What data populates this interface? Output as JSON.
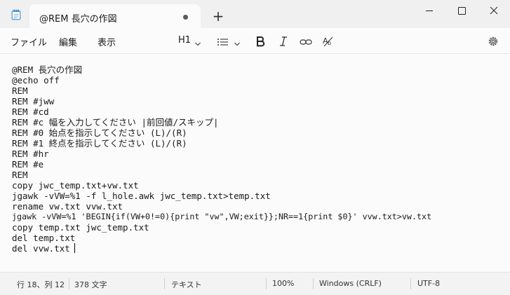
{
  "window": {
    "tab_title": "@REM 長穴の作図",
    "new_tab": "+",
    "controls": [
      "minimize",
      "maximize",
      "close"
    ]
  },
  "menu": {
    "file": "ファイル",
    "edit": "編集",
    "view": "表示"
  },
  "toolbar": {
    "heading": "H1",
    "icons": [
      "chevron-down-icon",
      "list-icon",
      "bold-icon",
      "italic-icon",
      "link-icon",
      "clear-format-icon",
      "gear-icon"
    ]
  },
  "editor": {
    "lines": [
      "",
      "@REM 長穴の作図",
      "@echo off",
      "REM",
      "REM #jww",
      "REM #cd",
      "REM #c 幅を入力してください |前回値/スキップ|",
      "REM #0 始点を指示してください (L)/(R)",
      "REM #1 終点を指示してください (L)/(R)",
      "REM #hr",
      "REM #e",
      "REM",
      "copy jwc_temp.txt+vw.txt",
      "jgawk -vVW=%1 -f l_hole.awk jwc_temp.txt>temp.txt",
      "rename vw.txt vvw.txt",
      "jgawk -vVW=%1 'BEGIN{if(VW+0!=0){print \"vw\",VW;exit}};NR==1{print $0}' vvw.txt>vw.txt",
      "copy temp.txt jwc_temp.txt",
      "del temp.txt",
      "del vvw.txt"
    ]
  },
  "status": {
    "position": "行 18、列 12",
    "chars": "378 文字",
    "format": "テキスト",
    "zoom": "100%",
    "line_ending": "Windows (CRLF)",
    "encoding": "UTF-8"
  }
}
